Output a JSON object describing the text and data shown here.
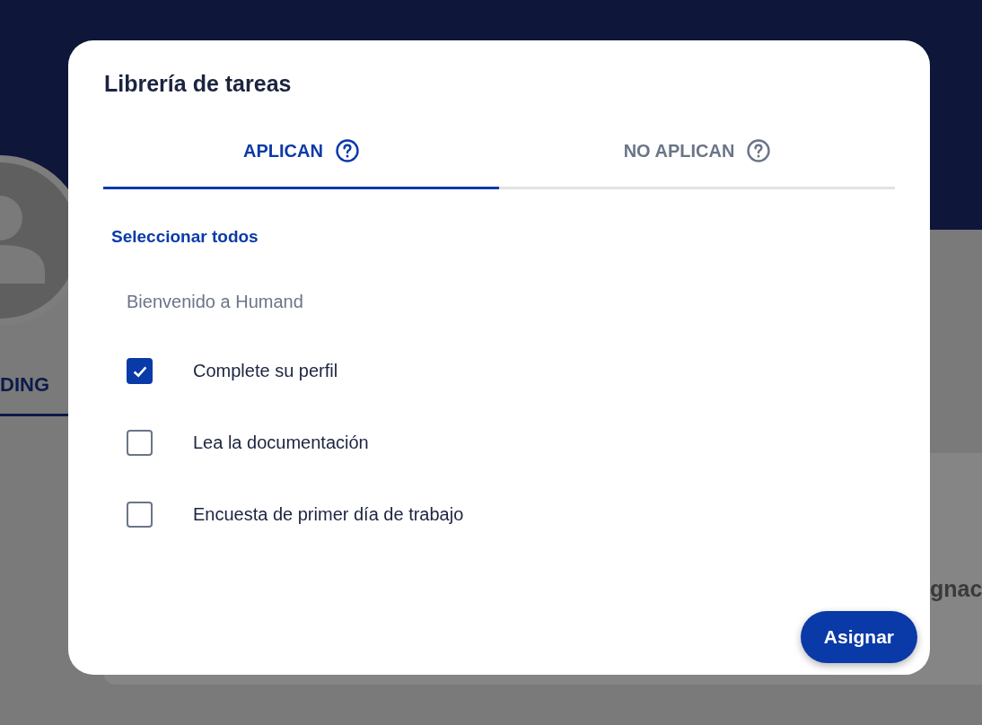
{
  "background": {
    "tab_label": "DING",
    "card_text": "gnac"
  },
  "dialog": {
    "title": "Librería de tareas",
    "tabs": [
      {
        "label": "APLICAN",
        "selected": true
      },
      {
        "label": "NO APLICAN",
        "selected": false
      }
    ],
    "select_all": "Seleccionar todos",
    "group": {
      "title": "Bienvenido a Humand",
      "tasks": [
        {
          "label": "Complete su perfil",
          "checked": true
        },
        {
          "label": "Lea la documentación",
          "checked": false
        },
        {
          "label": "Encuesta de primer día de trabajo",
          "checked": false
        }
      ]
    },
    "button": "Asignar"
  }
}
